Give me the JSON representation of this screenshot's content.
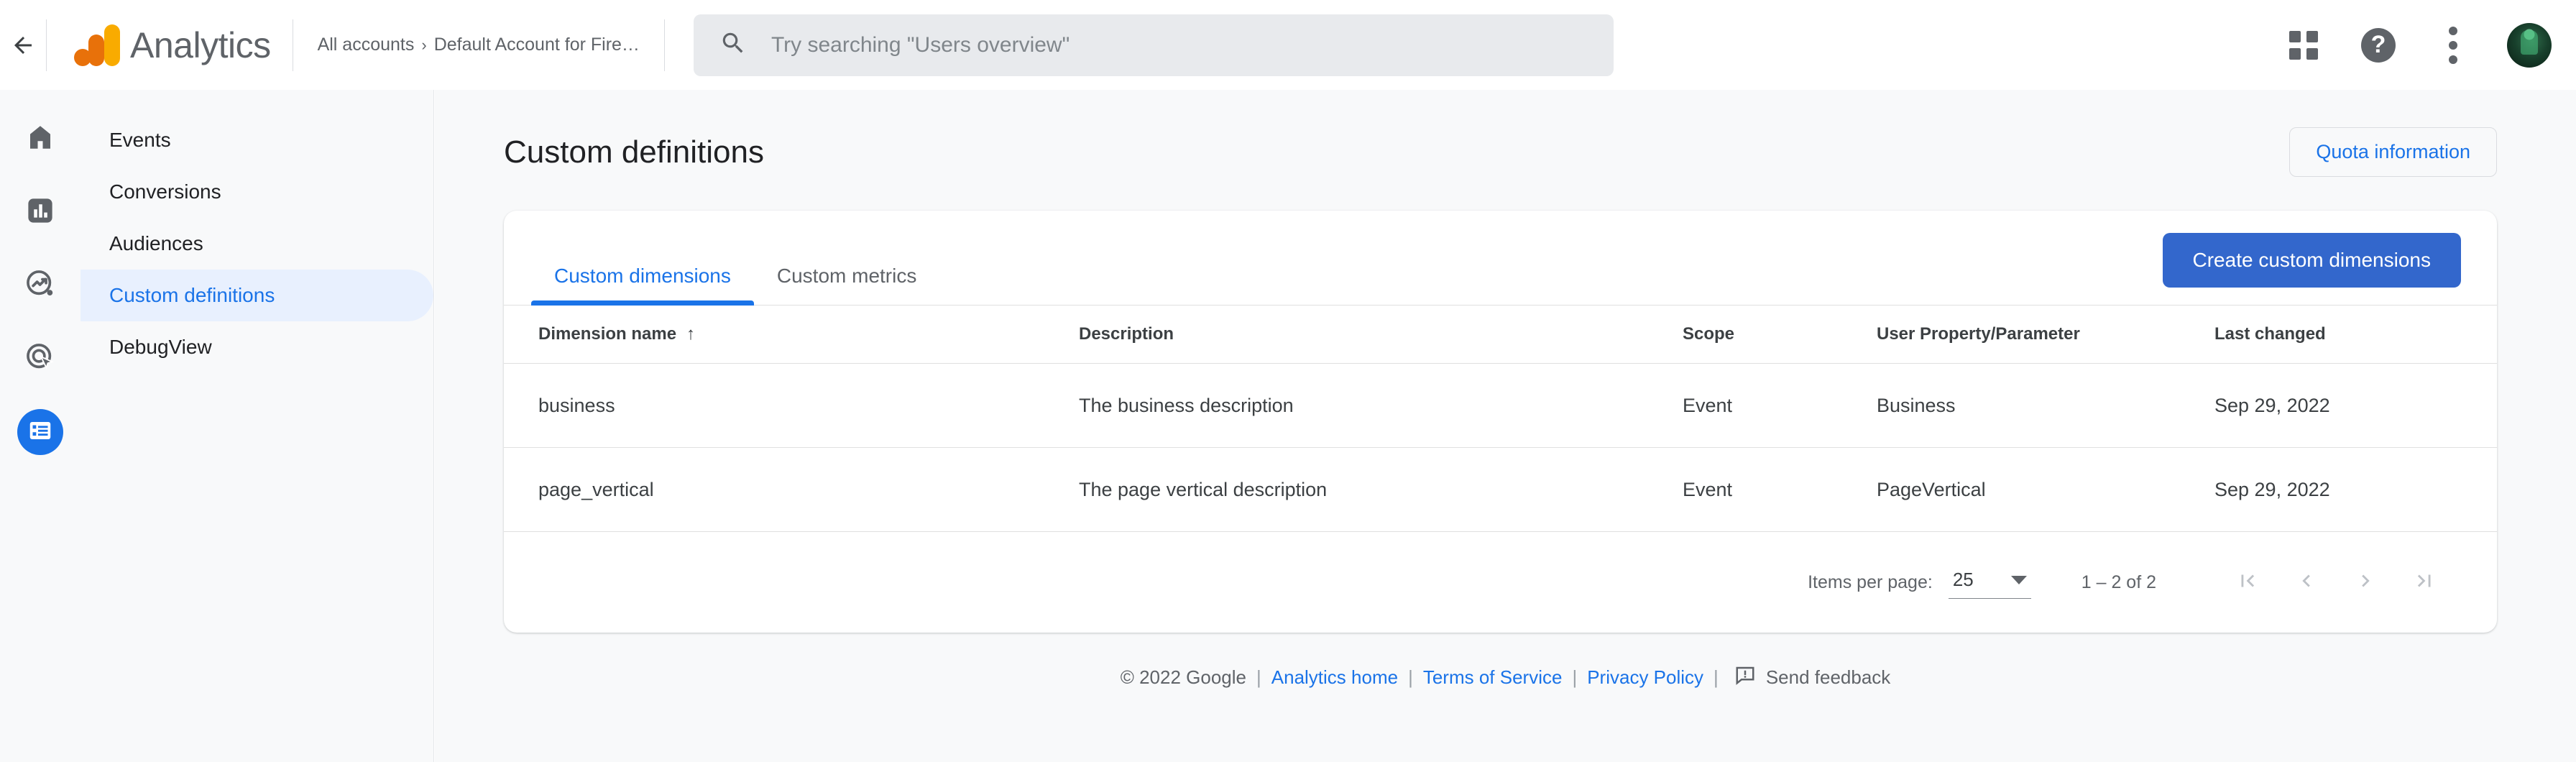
{
  "topbar": {
    "back_label": "back-arrow",
    "brand_name": "Analytics",
    "breadcrumb": {
      "root": "All accounts",
      "separator": "›",
      "account": "Default Account for Fire…"
    },
    "search": {
      "value": "",
      "placeholder": "Try searching \"Users overview\""
    },
    "actions": {
      "apps": "Google apps",
      "help": "?",
      "more": "More options",
      "avatar": "Account"
    }
  },
  "rail": {
    "items": [
      {
        "name": "home",
        "label": "Home",
        "active": false
      },
      {
        "name": "reports",
        "label": "Reports",
        "active": false
      },
      {
        "name": "explore",
        "label": "Explore",
        "active": false
      },
      {
        "name": "advertising",
        "label": "Advertising",
        "active": false
      },
      {
        "name": "configure",
        "label": "Configure",
        "active": true
      }
    ]
  },
  "nav": {
    "items": [
      {
        "label": "Events",
        "active": false
      },
      {
        "label": "Conversions",
        "active": false
      },
      {
        "label": "Audiences",
        "active": false
      },
      {
        "label": "Custom definitions",
        "active": true
      },
      {
        "label": "DebugView",
        "active": false
      }
    ]
  },
  "page": {
    "title": "Custom definitions",
    "quota_button": "Quota information"
  },
  "card": {
    "tabs": [
      {
        "label": "Custom dimensions",
        "active": true
      },
      {
        "label": "Custom metrics",
        "active": false
      }
    ],
    "create_button": "Create custom dimensions",
    "table": {
      "columns": [
        "Dimension name",
        "Description",
        "Scope",
        "User Property/Parameter",
        "Last changed"
      ],
      "sort": {
        "column": "Dimension name",
        "direction": "↑"
      },
      "rows": [
        {
          "name": "business",
          "description": "The business description",
          "scope": "Event",
          "property": "Business",
          "last_changed": "Sep 29, 2022"
        },
        {
          "name": "page_vertical",
          "description": "The page vertical description",
          "scope": "Event",
          "property": "PageVertical",
          "last_changed": "Sep 29, 2022"
        }
      ]
    },
    "pagination": {
      "items_per_page_label": "Items per page:",
      "items_per_page_value": "25",
      "range": "1 – 2 of 2",
      "first": "First page",
      "prev": "Previous page",
      "next": "Next page",
      "last": "Last page"
    }
  },
  "footer": {
    "copyright": "© 2022 Google",
    "sep": "|",
    "analytics_home": "Analytics home",
    "terms": "Terms of Service",
    "privacy": "Privacy Policy",
    "send_feedback": "Send feedback"
  },
  "colors": {
    "accent_blue": "#1a73e8",
    "button_blue": "#3367cc",
    "active_nav_bg": "#e8f0fe",
    "page_bg": "#f8f9fa",
    "logo_orange": "#e8710a",
    "logo_yellow": "#f9ab00",
    "text_primary": "#202124",
    "text_secondary": "#5f6368"
  }
}
